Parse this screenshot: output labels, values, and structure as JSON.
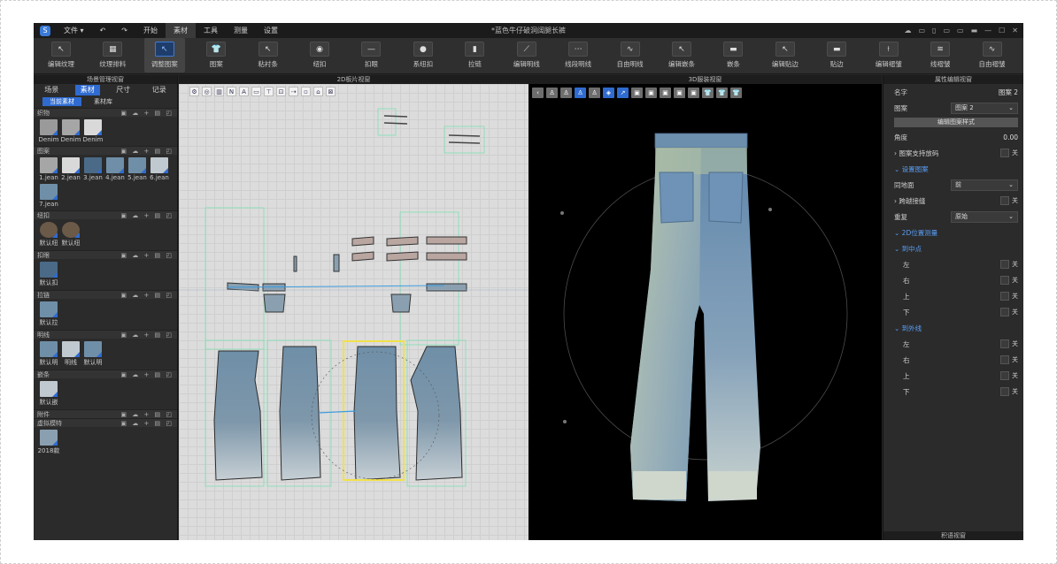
{
  "titlebar": {
    "logo": "S",
    "menus": [
      "文件 ▾",
      "↶",
      "↷",
      "开始",
      "素材",
      "工具",
      "测量",
      "设置"
    ],
    "active_menu": "素材",
    "document_title": "*蓝色牛仔破洞阔腿长裤",
    "window_icons": [
      "☁",
      "▭",
      "▯",
      "▭",
      "▭",
      "▬",
      "—",
      "☐",
      "✕"
    ]
  },
  "toolbar": {
    "tools": [
      {
        "label": "编辑纹理",
        "icon": "pointer-texture-icon",
        "glyph": "↖"
      },
      {
        "label": "纹理排料",
        "icon": "texture-layout-icon",
        "glyph": "▦"
      },
      {
        "label": "调整图案",
        "icon": "adjust-pattern-icon",
        "glyph": "↖",
        "selected": true
      },
      {
        "label": "图案",
        "icon": "graphic-icon",
        "glyph": "👕"
      },
      {
        "label": "粘衬条",
        "icon": "fusing-tape-icon",
        "glyph": "↖"
      },
      {
        "label": "纽扣",
        "icon": "button-icon",
        "glyph": "◉"
      },
      {
        "label": "扣眼",
        "icon": "buttonhole-icon",
        "glyph": "—"
      },
      {
        "label": "系纽扣",
        "icon": "fasten-button-icon",
        "glyph": "●"
      },
      {
        "label": "拉链",
        "icon": "zipper-icon",
        "glyph": "▮"
      },
      {
        "label": "编辑明线",
        "icon": "edit-topstitch-icon",
        "glyph": "⟋"
      },
      {
        "label": "线段明线",
        "icon": "segment-topstitch-icon",
        "glyph": "⋯"
      },
      {
        "label": "自由明线",
        "icon": "free-topstitch-icon",
        "glyph": "∿"
      },
      {
        "label": "编辑嵌条",
        "icon": "edit-piping-icon",
        "glyph": "↖"
      },
      {
        "label": "嵌条",
        "icon": "piping-icon",
        "glyph": "▬"
      },
      {
        "label": "编辑贴边",
        "icon": "edit-binding-icon",
        "glyph": "↖"
      },
      {
        "label": "贴边",
        "icon": "binding-icon",
        "glyph": "▬"
      },
      {
        "label": "编辑褶皱",
        "icon": "edit-pleat-icon",
        "glyph": "⟊"
      },
      {
        "label": "线褶皱",
        "icon": "line-pleat-icon",
        "glyph": "≋"
      },
      {
        "label": "自由褶皱",
        "icon": "free-pleat-icon",
        "glyph": "∿"
      }
    ]
  },
  "left_panel": {
    "title": "场景管理视窗",
    "tabs": [
      "场景",
      "素材",
      "尺寸",
      "记录"
    ],
    "active_tab": "素材",
    "subtabs": [
      "当前素材",
      "素材库"
    ],
    "active_subtab": "当前素材",
    "sections": [
      {
        "name": "织物",
        "items": [
          "Denim",
          "Denim",
          "Denim"
        ]
      },
      {
        "name": "图案",
        "items": [
          "1.jean",
          "2.jean",
          "3.jean",
          "4.jean",
          "5.jean",
          "6.jean",
          "7.jean"
        ]
      },
      {
        "name": "纽扣",
        "items": [
          "默认纽",
          "默认纽"
        ]
      },
      {
        "name": "扣眼",
        "items": [
          "默认扣"
        ]
      },
      {
        "name": "拉链",
        "items": [
          "默认拉"
        ]
      },
      {
        "name": "明线",
        "items": [
          "默认明",
          "明线",
          "默认明"
        ]
      },
      {
        "name": "嵌条",
        "items": [
          "默认嵌"
        ]
      },
      {
        "name": "附件",
        "items": []
      },
      {
        "name": "虚拟模特",
        "items": [
          "2018款"
        ]
      }
    ],
    "section_ops": "▣ ☁ + ▤ ◰"
  },
  "view2d": {
    "title": "2D板片视窗"
  },
  "view3d": {
    "title": "3D服装视窗"
  },
  "right_panel": {
    "title": "属性编辑视窗",
    "name_label": "名字",
    "name_value": "图案 2",
    "pattern_label": "图案",
    "pattern_value": "图案 2",
    "edit_style_button": "编辑图案样式",
    "angle_label": "角度",
    "angle_value": "0.00",
    "support_label": "图案支持放码",
    "off_label": "关",
    "settings_group": "设置图案",
    "same_label": "同地面",
    "same_value": "前",
    "cross_label": "跨越接缝",
    "repeat_label": "重复",
    "repeat_value": "原始",
    "pos2d_group": "2D位置测量",
    "to_center_group": "到中点",
    "to_outline_group": "到外线",
    "dirs": [
      "左",
      "右",
      "上",
      "下"
    ],
    "footer": "积语视窗"
  },
  "colors": {
    "accent": "#2f6bd0",
    "highlight_piece": "#f2e14a"
  }
}
